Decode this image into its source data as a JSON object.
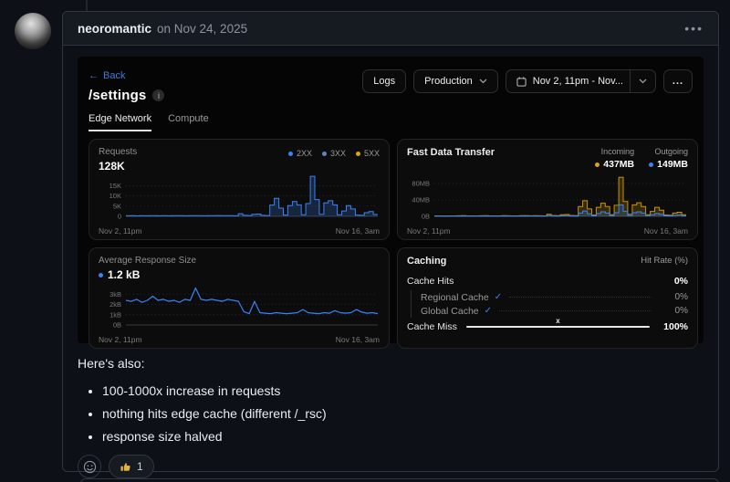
{
  "comment": {
    "author": "neoromantic",
    "date_text": "on Nov 24, 2025",
    "kebab": "•••",
    "body_intro": "Here's also:",
    "bullets": [
      "100-1000x increase in requests",
      "nothing hits edge cache (different /_rsc)",
      "response size halved"
    ],
    "reactions": {
      "thumbs_up_count": "1"
    }
  },
  "dashboard": {
    "back_label": "Back",
    "back_arrow": "←",
    "path_title": "/settings",
    "info_glyph": "i",
    "buttons": {
      "logs": "Logs",
      "environment": "Production",
      "date_range": "Nov 2, 11pm - Nov...",
      "more": "..."
    },
    "tabs": [
      {
        "label": "Edge Network"
      },
      {
        "label": "Compute"
      }
    ]
  },
  "colors": {
    "link_blue": "#3f7bd9",
    "chart_blue": "#3b82f6",
    "chart_blue_muted": "#5c87c7",
    "chart_yellow": "#c99400",
    "check_blue": "#3b82f6"
  },
  "chart_data": [
    {
      "id": "requests",
      "type": "area-step",
      "title": "Requests",
      "total": "128K",
      "legend": [
        {
          "label": "2XX",
          "color": "#3b82f6"
        },
        {
          "label": "3XX",
          "color": "#5c87c7"
        },
        {
          "label": "5XX",
          "color": "#d9a514"
        }
      ],
      "ylim": [
        0,
        20
      ],
      "yticks": [
        {
          "v": 15,
          "label": "15K"
        },
        {
          "v": 10,
          "label": "10K"
        },
        {
          "v": 5,
          "label": "5K"
        },
        {
          "v": 0,
          "label": "0"
        }
      ],
      "x_start": "Nov 2, 11pm",
      "x_end": "Nov 16, 3am",
      "series": [
        {
          "name": "2XX",
          "color": "#3b82f6",
          "values": [
            0.25,
            0.3,
            0.2,
            0.3,
            0.25,
            0.3,
            0.35,
            0.25,
            0.3,
            0.25,
            0.3,
            0.35,
            0.3,
            0.25,
            0.3,
            0.35,
            0.3,
            0.25,
            0.3,
            0.35,
            0.4,
            0.3,
            0.35,
            0.3,
            0.25,
            1.3,
            0.5,
            0.4,
            1.0,
            1.1,
            0.5,
            0.4,
            5.5,
            8.8,
            4.0,
            0.6,
            5.2,
            7.2,
            5.6,
            0.8,
            6.2,
            19.5,
            8.2,
            1.0,
            6.6,
            7.6,
            5.6,
            0.8,
            2.6,
            5.2,
            3.6,
            0.6,
            0.5,
            1.8,
            2.3,
            0.9
          ]
        }
      ]
    },
    {
      "id": "transfer",
      "type": "area-step",
      "title": "Fast Data Transfer",
      "legend": [
        {
          "label": "Incoming",
          "value": "437MB",
          "color": "#d9a514"
        },
        {
          "label": "Outgoing",
          "value": "149MB",
          "color": "#3b82f6"
        }
      ],
      "ylim": [
        0,
        100
      ],
      "yticks": [
        {
          "v": 80,
          "label": "80MB"
        },
        {
          "v": 40,
          "label": "40MB"
        },
        {
          "v": 0,
          "label": "0B"
        }
      ],
      "x_start": "Nov 2, 11pm",
      "x_end": "Nov 16, 3am",
      "series": [
        {
          "name": "Incoming",
          "color": "#c99400",
          "values": [
            1,
            1.2,
            0.8,
            1.1,
            1,
            1.3,
            1.5,
            1,
            1.2,
            1,
            1.3,
            1.5,
            1.2,
            1,
            1.2,
            1.5,
            1.3,
            1,
            1.2,
            1.5,
            1.8,
            1.3,
            1.5,
            1.3,
            1,
            5,
            2,
            1.5,
            4,
            4.5,
            2,
            1.5,
            24,
            38,
            18,
            3,
            22,
            32,
            24,
            4,
            27,
            95,
            36,
            5,
            28,
            33,
            24,
            4,
            12,
            22,
            15,
            3,
            2.5,
            8,
            10,
            4
          ]
        },
        {
          "name": "Outgoing",
          "color": "#3b82f6",
          "values": [
            0.4,
            0.5,
            0.3,
            0.45,
            0.4,
            0.5,
            0.6,
            0.4,
            0.5,
            0.4,
            0.5,
            0.6,
            0.5,
            0.4,
            0.5,
            0.6,
            0.5,
            0.4,
            0.5,
            0.6,
            0.7,
            0.5,
            0.6,
            0.5,
            0.4,
            2,
            0.8,
            0.6,
            1.5,
            1.7,
            0.8,
            0.6,
            8,
            13,
            6,
            1,
            7,
            11,
            8,
            1.5,
            9,
            28,
            12,
            1.8,
            9,
            11,
            8,
            1.5,
            4,
            7,
            5,
            1,
            0.9,
            2.5,
            3.5,
            1.4
          ]
        }
      ]
    },
    {
      "id": "response",
      "type": "line",
      "title": "Average Response Size",
      "current": "1.2 kB",
      "ylim": [
        0,
        4
      ],
      "yticks": [
        {
          "v": 3,
          "label": "3kB"
        },
        {
          "v": 2,
          "label": "2kB"
        },
        {
          "v": 1,
          "label": "1kB"
        },
        {
          "v": 0,
          "label": "0B"
        }
      ],
      "x_start": "Nov 2, 11pm",
      "x_end": "Nov 16, 3am",
      "series": [
        {
          "name": "Average Response Size",
          "color": "#3b82f6",
          "values": [
            2.4,
            2.3,
            2.5,
            2.2,
            2.4,
            2.8,
            2.4,
            2.5,
            2.3,
            2.4,
            2.2,
            2.5,
            2.4,
            3.6,
            2.5,
            2.4,
            2.5,
            2.4,
            2.3,
            2.5,
            2.4,
            2.3,
            1.3,
            1.1,
            2.3,
            1.2,
            1.15,
            1.1,
            1.2,
            1.15,
            1.1,
            1.15,
            1.2,
            1.5,
            1.2,
            1.15,
            1.1,
            1.2,
            1.15,
            1.4,
            1.2,
            1.15,
            1.2,
            1.5,
            1.25,
            1.15,
            1.2,
            1.1
          ]
        }
      ]
    },
    {
      "id": "caching",
      "type": "table",
      "title": "Caching",
      "right_label": "Hit Rate (%)",
      "rows": {
        "cache_hits": {
          "label": "Cache Hits",
          "value": "0%"
        },
        "regional": {
          "label": "Regional Cache",
          "check": "✓",
          "value": "0%"
        },
        "global": {
          "label": "Global Cache",
          "check": "✓",
          "value": "0%"
        },
        "cache_miss": {
          "label": "Cache Miss",
          "marker": "x",
          "value": "100%",
          "bar_width": "100%"
        }
      }
    }
  ]
}
